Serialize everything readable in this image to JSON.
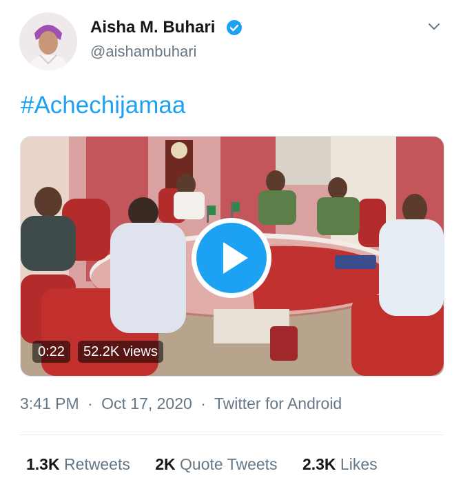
{
  "author": {
    "name": "Aisha M. Buhari",
    "handle": "@aishambuhari",
    "avatar_icon": "profile-photo",
    "verified_icon": "verified-badge-icon"
  },
  "tweet": {
    "hashtag": "#Achechijamaa"
  },
  "video": {
    "duration": "0:22",
    "views": "52.2K views",
    "play_icon": "play-icon"
  },
  "meta": {
    "time": "3:41 PM",
    "date": "Oct 17, 2020",
    "separator": "·",
    "source": "Twitter for Android"
  },
  "stats": {
    "retweets_count": "1.3K",
    "retweets_label": "Retweets",
    "quotes_count": "2K",
    "quotes_label": "Quote Tweets",
    "likes_count": "2.3K",
    "likes_label": "Likes"
  },
  "colors": {
    "accent": "#1da1f2",
    "secondary_text": "#657786"
  }
}
